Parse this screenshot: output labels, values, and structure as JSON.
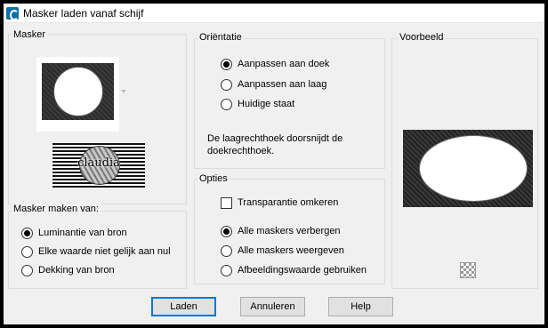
{
  "window": {
    "title": "Masker laden vanaf schijf",
    "icon": "psp-app-icon"
  },
  "masker": {
    "label": "Masker",
    "logo_text": "claudia"
  },
  "maken_van": {
    "label": "Masker maken van:",
    "options": [
      {
        "label": "Luminantie van bron",
        "selected": true
      },
      {
        "label": "Elke waarde niet gelijk aan nul",
        "selected": false
      },
      {
        "label": "Dekking van bron",
        "selected": false
      }
    ]
  },
  "orientatie": {
    "label": "Oriëntatie",
    "options": [
      {
        "label": "Aanpassen aan doek",
        "selected": true
      },
      {
        "label": "Aanpassen aan laag",
        "selected": false
      },
      {
        "label": "Huidige staat",
        "selected": false
      }
    ],
    "description": "De laagrechthoek doorsnijdt de doekrechthoek."
  },
  "opties": {
    "label": "Opties",
    "invert": {
      "label": "Transparantie omkeren",
      "checked": false
    },
    "options": [
      {
        "label": "Alle maskers verbergen",
        "selected": true
      },
      {
        "label": "Alle maskers weergeven",
        "selected": false
      },
      {
        "label": "Afbeeldingswaarde gebruiken",
        "selected": false
      }
    ]
  },
  "voorbeeld": {
    "label": "Voorbeeld"
  },
  "buttons": {
    "load": "Laden",
    "cancel": "Annuleren",
    "help": "Help"
  },
  "colors": {
    "background": "#f0f0f0",
    "frame": "#000000",
    "default_button_border": "#0078d7"
  }
}
